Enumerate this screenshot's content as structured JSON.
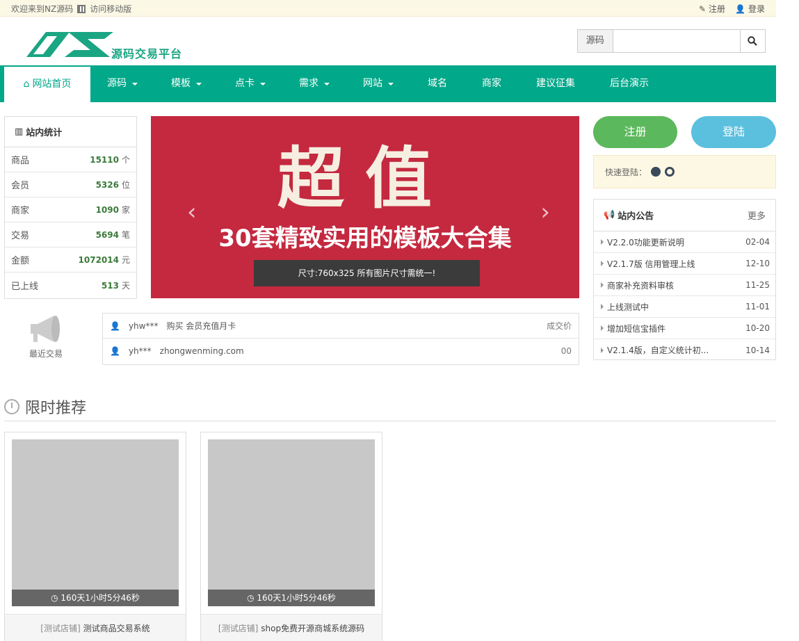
{
  "topbar": {
    "welcome": "欢迎来到NZ源码",
    "mobile": "访问移动版",
    "register": "注册",
    "login": "登录"
  },
  "header": {
    "logo_text": "源码交易平台",
    "search_category": "源码",
    "search_placeholder": ""
  },
  "nav": [
    {
      "label": "网站首页",
      "dropdown": false,
      "active": true
    },
    {
      "label": "源码",
      "dropdown": true
    },
    {
      "label": "模板",
      "dropdown": true
    },
    {
      "label": "点卡",
      "dropdown": true
    },
    {
      "label": "需求",
      "dropdown": true
    },
    {
      "label": "网站",
      "dropdown": true
    },
    {
      "label": "域名",
      "dropdown": false
    },
    {
      "label": "商家",
      "dropdown": false
    },
    {
      "label": "建议征集",
      "dropdown": false
    },
    {
      "label": "后台演示",
      "dropdown": false
    }
  ],
  "stats": {
    "title": "站内统计",
    "rows": [
      {
        "label": "商品",
        "value": "15110",
        "unit": "个"
      },
      {
        "label": "会员",
        "value": "5326",
        "unit": "位"
      },
      {
        "label": "商家",
        "value": "1090",
        "unit": "家"
      },
      {
        "label": "交易",
        "value": "5694",
        "unit": "笔"
      },
      {
        "label": "金额",
        "value": "1072014",
        "unit": "元"
      },
      {
        "label": "已上线",
        "value": "513",
        "unit": "天"
      }
    ]
  },
  "banner": {
    "big": "超值",
    "sub": "30套精致实用的模板大合集",
    "note": "尺寸:760x325 所有图片尺寸需统一!"
  },
  "trades": {
    "label": "最近交易",
    "rows": [
      {
        "user": "yhw***",
        "desc": "购买 会员充值月卡",
        "status": "成交价"
      },
      {
        "user": "yh***",
        "desc": "zhongwenming.com",
        "status": "00"
      }
    ]
  },
  "auth": {
    "register": "注册",
    "login": "登陆",
    "quick_login": "快速登陆："
  },
  "notice": {
    "title": "站内公告",
    "more": "更多",
    "items": [
      {
        "text": "V2.2.0功能更新说明",
        "date": "02-04"
      },
      {
        "text": "V2.1.7版 信用管理上线",
        "date": "12-10"
      },
      {
        "text": "商家补充资料审核",
        "date": "11-25"
      },
      {
        "text": "上线测试中",
        "date": "11-01"
      },
      {
        "text": "增加短信宝插件",
        "date": "10-20"
      },
      {
        "text": "V2.1.4版，自定义统计初...",
        "date": "10-14"
      }
    ]
  },
  "section": {
    "title": "限时推荐"
  },
  "products": [
    {
      "timer": "160天1小时5分46秒",
      "shop": "[测试店铺]",
      "name": "测试商品交易系统"
    },
    {
      "timer": "160天1小时5分46秒",
      "shop": "[测试店铺]",
      "name": "shop免费开源商城系统源码"
    }
  ],
  "colors": {
    "brand": "#02a88a",
    "register": "#5cb85c",
    "login": "#5bc0de",
    "banner": "#c4293f"
  }
}
